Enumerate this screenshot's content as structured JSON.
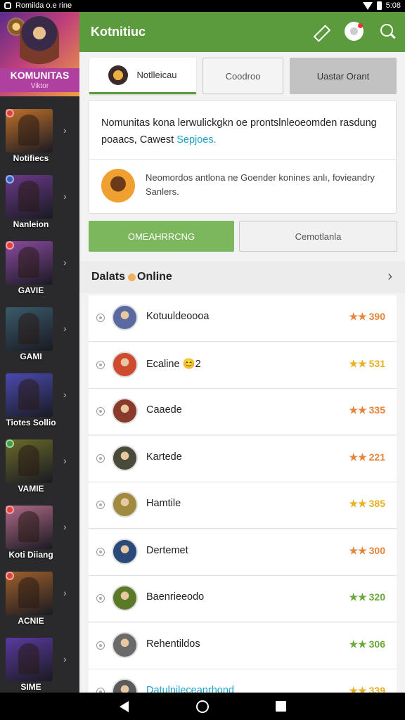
{
  "status_bar": {
    "app_name": "Romilda o.e rine",
    "time": "5:08"
  },
  "colors": {
    "brand_green": "#5c9a3e",
    "accent_green": "#7cb75e",
    "link_blue": "#1da1c8",
    "sidebar_bg": "#2a2a2c"
  },
  "sidebar": {
    "brand_title": "KOMUNITAS",
    "brand_sub": "Viktor",
    "items": [
      {
        "label": "Notifiecs",
        "thumb": "#c0702a",
        "dot": "#e04040"
      },
      {
        "label": "Nanleion",
        "thumb": "#6a3a8a",
        "dot": "#3060c0"
      },
      {
        "label": "GAVIE",
        "thumb": "#8a4aa0",
        "dot": "#e04040"
      },
      {
        "label": "GAMI",
        "thumb": "#3a5a6a",
        "dot": ""
      },
      {
        "label": "Tiotes Sollio",
        "thumb": "#4a4ab0",
        "dot": ""
      },
      {
        "label": "VAMIE",
        "thumb": "#6a6a2a",
        "dot": "#40a040"
      },
      {
        "label": "Koti Diiang",
        "thumb": "#b06a8a",
        "dot": "#e04040"
      },
      {
        "label": "ACNIE",
        "thumb": "#a0602a",
        "dot": "#e04040"
      },
      {
        "label": "SIME",
        "thumb": "#5a3aa0",
        "dot": ""
      }
    ]
  },
  "appbar": {
    "title": "Kotnitiuc"
  },
  "tabs": {
    "active": "Notlleicau",
    "middle": "Coodroo",
    "right": "Uastar Orant"
  },
  "card": {
    "text": "Nomunitas kona lerwulickgkn oe prontslnleoeomden rasdung poaacs, Cawest",
    "link": "Sepjoes.",
    "secondary": "Neomordos antlona ne Goender konines anlı, fovieandry Sanlers."
  },
  "buttons": {
    "primary": "OMEAHRRCNG",
    "secondary": "Cemotlanla"
  },
  "section": {
    "title_part1": "Dalats",
    "title_part2": "Online"
  },
  "players": [
    {
      "name": "Kotuuldeoooa",
      "stars": "★★",
      "score": "390",
      "color": "#e8843a",
      "avatar": "#5a6aa0"
    },
    {
      "name": "Ecaline 😊2",
      "stars": "★★",
      "score": "531",
      "color": "#e8b020",
      "avatar": "#d04a30"
    },
    {
      "name": "Caaede",
      "stars": "★★",
      "score": "335",
      "color": "#e8843a",
      "avatar": "#8a3a2a"
    },
    {
      "name": "Kartede",
      "stars": "★★",
      "score": "221",
      "color": "#e8843a",
      "avatar": "#4a4a3a"
    },
    {
      "name": "Hamtile",
      "stars": "★★",
      "score": "385",
      "color": "#e8b020",
      "avatar": "#a08a40"
    },
    {
      "name": "Dertemet",
      "stars": "★★",
      "score": "300",
      "color": "#e8843a",
      "avatar": "#2a4a7a"
    },
    {
      "name": "Baenrieeodo",
      "stars": "★★",
      "score": "320",
      "color": "#6aaa3a",
      "avatar": "#5a7a2a"
    },
    {
      "name": "Rehentildos",
      "stars": "★★",
      "score": "306",
      "color": "#6aaa3a",
      "avatar": "#6a6a6a"
    },
    {
      "name": "Datulnileceanrhond",
      "stars": "★★",
      "score": "339",
      "color": "#e8b020",
      "avatar": "#5a5a5a"
    }
  ]
}
